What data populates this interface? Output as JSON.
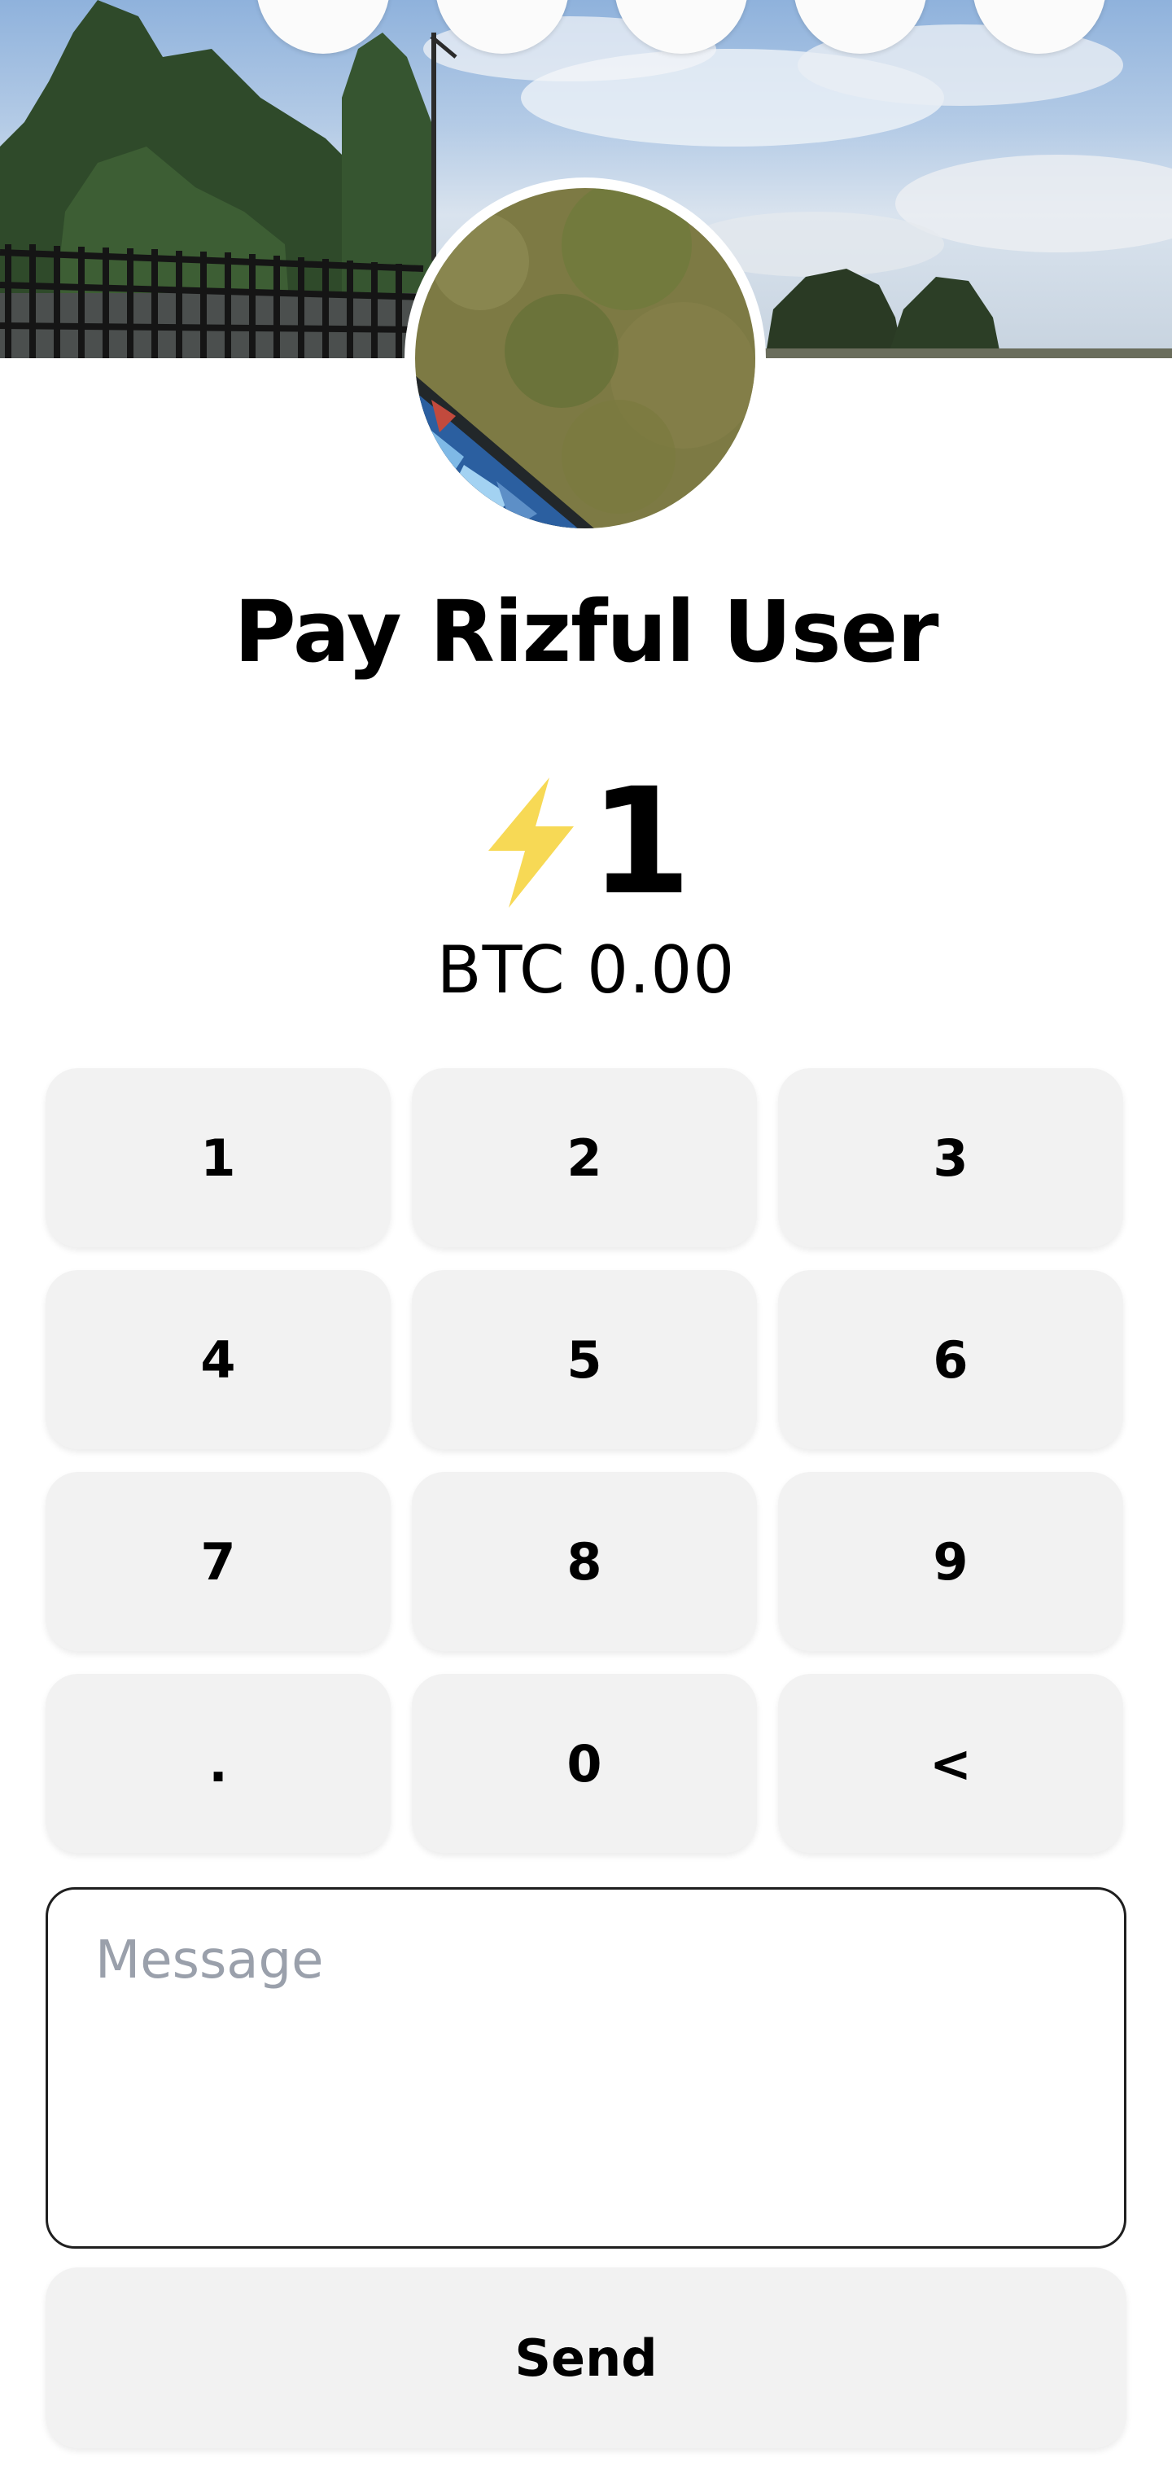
{
  "header": {
    "banner_alt": "profile banner",
    "action_icons": [
      "grid-icon",
      "message-icon",
      "zap-icon",
      "edit-icon",
      "menu-icon"
    ]
  },
  "title": "Pay Rizful User",
  "amount": {
    "value": "1",
    "fiat": "BTC 0.00",
    "accent_color": "#f7d955"
  },
  "keypad": {
    "keys": [
      "1",
      "2",
      "3",
      "4",
      "5",
      "6",
      "7",
      "8",
      "9",
      ".",
      "0",
      "<"
    ]
  },
  "message": {
    "placeholder": "Message",
    "value": ""
  },
  "send_label": "Send"
}
